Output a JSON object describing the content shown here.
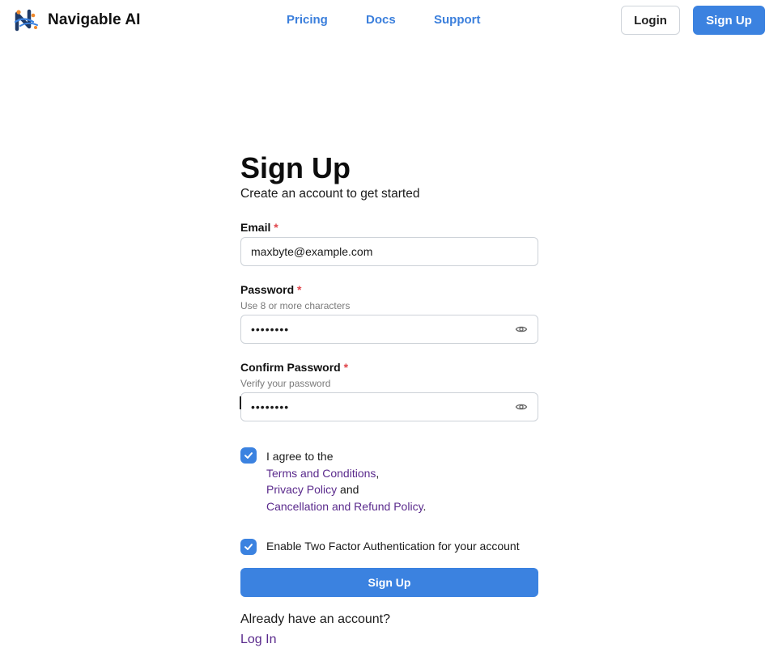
{
  "header": {
    "brand": "Navigable AI",
    "nav": [
      "Pricing",
      "Docs",
      "Support"
    ],
    "login_label": "Login",
    "signup_label": "Sign Up"
  },
  "form": {
    "title": "Sign Up",
    "subtitle": "Create an account to get started",
    "email": {
      "label": "Email",
      "required": "*",
      "value": "maxbyte@example.com"
    },
    "password": {
      "label": "Password",
      "required": "*",
      "hint": "Use 8 or more characters",
      "masked_value": "••••••••"
    },
    "confirm_password": {
      "label": "Confirm Password",
      "required": "*",
      "hint": "Verify your password",
      "masked_value": "••••••••"
    },
    "agree": {
      "checked": true,
      "prefix": "I agree to the",
      "terms": "Terms and Conditions",
      "comma": ",",
      "privacy": "Privacy Policy",
      "and": "and",
      "refund": "Cancellation and Refund Policy",
      "period": "."
    },
    "two_factor": {
      "checked": true,
      "label": "Enable Two Factor Authentication for your account"
    },
    "submit_label": "Sign Up",
    "have_account": "Already have an account?",
    "login_link": "Log In"
  },
  "colors": {
    "accent": "#3b82e0",
    "link": "#5a2a8c",
    "required": "#e0464c"
  },
  "icons": [
    "logo-icon",
    "eye-icon",
    "checkmark-icon"
  ]
}
